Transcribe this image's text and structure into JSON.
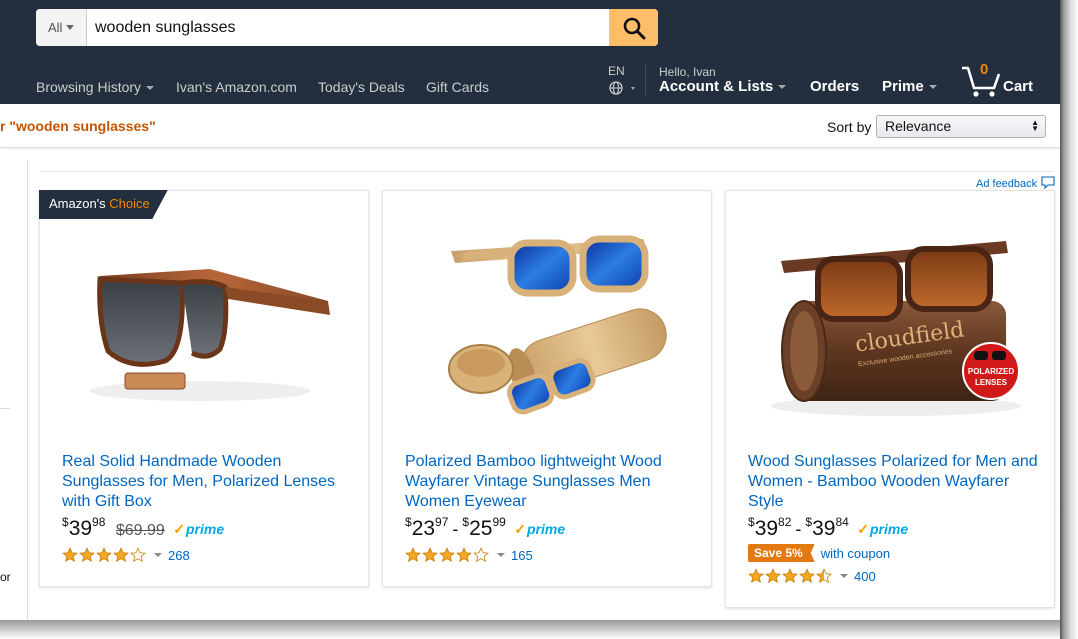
{
  "search": {
    "category": "All",
    "query": "wooden sunglasses"
  },
  "nav": {
    "links": [
      "Browsing History",
      "Ivan's Amazon.com",
      "Today's Deals",
      "Gift Cards"
    ],
    "language": "EN",
    "greeting": "Hello, Ivan",
    "account": "Account & Lists",
    "orders": "Orders",
    "prime": "Prime",
    "cart_count": "0",
    "cart_label": "Cart"
  },
  "results": {
    "query_label": "r \"wooden sunglasses\"",
    "sort_label": "Sort by",
    "sort_value": "Relevance",
    "ad_feedback": "Ad feedback",
    "sidebar_fragment": "or"
  },
  "colors": {
    "header_bg": "#232f3e",
    "search_button": "#febd69",
    "link": "#0066c0",
    "query_orange": "#c45500",
    "star": "#f5a623"
  },
  "products": [
    {
      "badge_prefix": "Amazon's",
      "badge_highlight": "Choice",
      "title": "Real Solid Handmade Wooden Sunglasses for Men, Polarized Lenses with Gift Box",
      "price": {
        "currency": "$",
        "whole": "39",
        "fraction": "98"
      },
      "list_price": "$69.99",
      "prime": "prime",
      "rating": 4.0,
      "reviews": "268"
    },
    {
      "title": "Polarized Bamboo lightweight Wood Wayfarer Vintage Sunglasses Men Women Eyewear",
      "price_low": {
        "currency": "$",
        "whole": "23",
        "fraction": "97"
      },
      "price_high": {
        "currency": "$",
        "whole": "25",
        "fraction": "99"
      },
      "prime": "prime",
      "rating": 4.0,
      "reviews": "165"
    },
    {
      "title": "Wood Sunglasses Polarized for Men and Women - Bamboo Wooden Wayfarer Style",
      "price_low": {
        "currency": "$",
        "whole": "39",
        "fraction": "82"
      },
      "price_high": {
        "currency": "$",
        "whole": "39",
        "fraction": "84"
      },
      "prime": "prime",
      "coupon_badge": "Save 5%",
      "coupon_text": "with coupon",
      "rating": 4.5,
      "reviews": "400",
      "brand_text": "cloudfield",
      "brand_sub": "Exclusive wooden accessories",
      "lens_badge": [
        "POLARIZED",
        "LENSES"
      ]
    }
  ]
}
